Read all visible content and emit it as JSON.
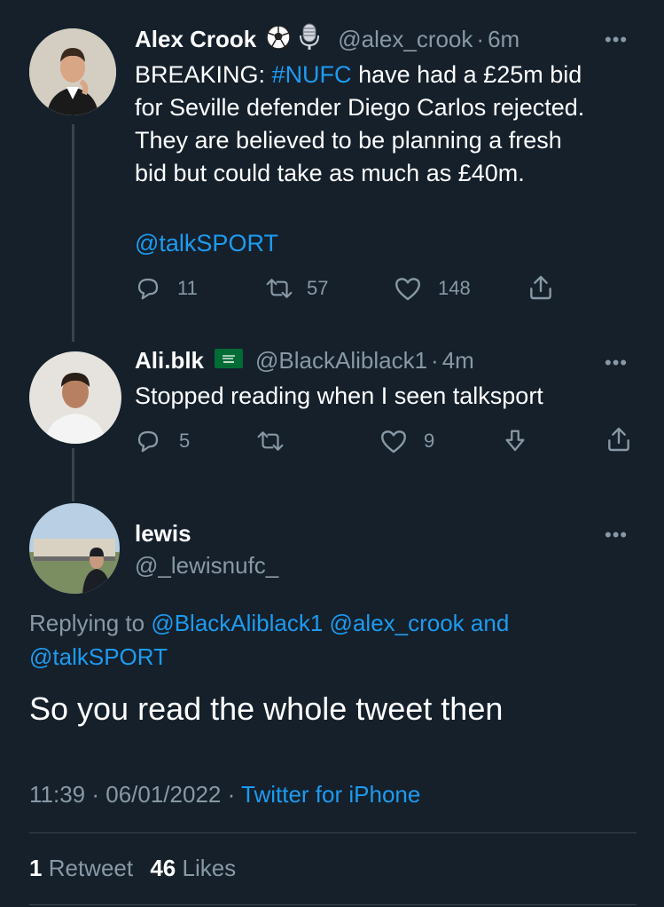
{
  "tweet1": {
    "name": "Alex Crook",
    "handle": "@alex_crook",
    "time": "6m",
    "lines": [
      [
        "BREAKING: ",
        "#NUFC",
        " have had a £25m bid"
      ],
      "for Seville defender Diego Carlos rejected.",
      "They are believed to be planning a fresh",
      "bid but could take as much as £40m."
    ],
    "mention": "@talkSPORT",
    "replies": "11",
    "retweets": "57",
    "likes": "148"
  },
  "tweet2": {
    "name": "Ali.blk",
    "handle": "@BlackAliblack1",
    "time": "4m",
    "text": "Stopped reading when I seen talksport",
    "replies": "5",
    "likes": "9"
  },
  "tweet3": {
    "name": "lewis",
    "handle": "@_lewisnufc_",
    "replying_prefix": "Replying to",
    "replying_mentions": "@BlackAliblack1 @alex_crook and",
    "replying_mentions2": "@talkSPORT",
    "text": "So you read the whole tweet then",
    "timestamp": "11:39 · 06/01/2022 · ",
    "source": "Twitter for iPhone",
    "retweet_count": "1",
    "retweet_label": "Retweet",
    "like_count": "46",
    "like_label": "Likes"
  },
  "separator": "·",
  "more_label": "•••",
  "colors": {
    "background": "#15202b",
    "link": "#1d9bf0",
    "secondary": "#8899a6",
    "line": "#38444d"
  }
}
